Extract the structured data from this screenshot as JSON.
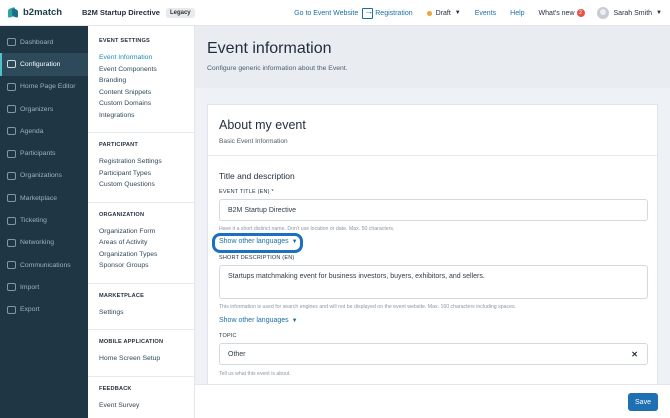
{
  "topbar": {
    "brand": "b2match",
    "event_name": "B2M Startup Directive",
    "legacy_badge": "Legacy",
    "go_to_event": "Go to Event Website",
    "registration": "Registration",
    "status": "Draft",
    "events": "Events",
    "help": "Help",
    "whats_new": "What's new",
    "whats_new_count": "2",
    "user_name": "Sarah Smith",
    "status_color": "#f2a23a"
  },
  "sidebar": {
    "items": [
      {
        "label": "Dashboard",
        "icon": "dashboard-icon"
      },
      {
        "label": "Configuration",
        "icon": "gear-icon"
      },
      {
        "label": "Home Page Editor",
        "icon": "edit-icon"
      },
      {
        "label": "Organizers",
        "icon": "users-icon"
      },
      {
        "label": "Agenda",
        "icon": "calendar-icon"
      },
      {
        "label": "Participants",
        "icon": "participants-icon"
      },
      {
        "label": "Organizations",
        "icon": "building-icon"
      },
      {
        "label": "Marketplace",
        "icon": "marketplace-icon"
      },
      {
        "label": "Ticketing",
        "icon": "ticket-icon"
      },
      {
        "label": "Networking",
        "icon": "networking-icon"
      },
      {
        "label": "Communications",
        "icon": "chat-icon"
      },
      {
        "label": "Import",
        "icon": "import-icon"
      },
      {
        "label": "Export",
        "icon": "export-icon"
      }
    ],
    "active": "Configuration"
  },
  "settings": {
    "groups": [
      {
        "title": "EVENT SETTINGS",
        "items": [
          "Event Information",
          "Event Components",
          "Branding",
          "Content Snippets",
          "Custom Domains",
          "Integrations"
        ]
      },
      {
        "title": "PARTICIPANT",
        "items": [
          "Registration Settings",
          "Participant Types",
          "Custom Questions"
        ]
      },
      {
        "title": "ORGANIZATION",
        "items": [
          "Organization Form",
          "Areas of Activity",
          "Organization Types",
          "Sponsor Groups"
        ]
      },
      {
        "title": "MARKETPLACE",
        "items": [
          "Settings"
        ]
      },
      {
        "title": "MOBILE APPLICATION",
        "items": [
          "Home Screen Setup"
        ]
      },
      {
        "title": "FEEDBACK",
        "items": [
          "Event Survey"
        ]
      }
    ]
  },
  "main": {
    "title": "Event information",
    "subtitle": "Configure generic information about the Event.",
    "card_title": "About my event",
    "card_subtitle": "Basic Event Information",
    "section_title": "Title and description",
    "title_label": "EVENT TITLE (EN) *",
    "title_value": "B2M Startup Directive",
    "title_helper": "Have it a short distinct name. Don't use location or date. Max. 50 characters.",
    "show_other_languages": "Show other languages",
    "short_desc_label": "SHORT DESCRIPTION (EN)",
    "short_desc_value": "Startups matchmaking event for business investors, buyers, exhibitors, and sellers.",
    "short_desc_helper": "This information is used for search engines and will not be displayed on the event website. Max. 160 characters including spaces.",
    "topic_label": "TOPIC",
    "topic_value": "Other",
    "topic_helper": "Tell us what this event is about."
  },
  "footer": {
    "save": "Save"
  },
  "colors": {
    "sidebar_bg": "#1f3744",
    "accent": "#1b6fa8",
    "save_button": "#1f6fb3",
    "highlight_ring": "#1d6fbf"
  }
}
